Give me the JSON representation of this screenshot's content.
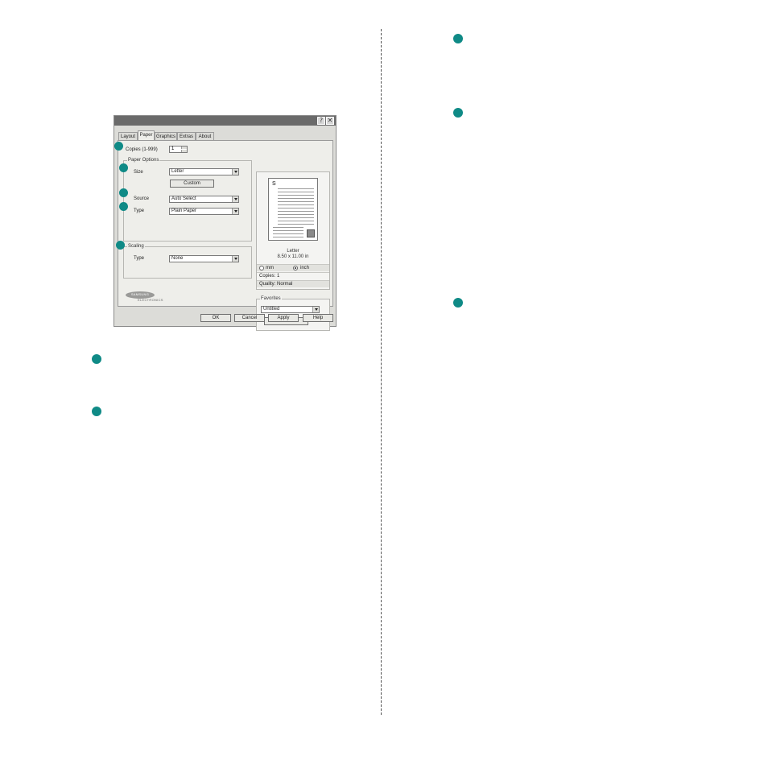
{
  "dialog": {
    "title_buttons": {
      "help": "?",
      "close": "✕"
    },
    "tabs": [
      "Layout",
      "Paper",
      "Graphics",
      "Extras",
      "About"
    ],
    "active_tab": "Paper",
    "copies": {
      "label": "Copies (1-999)",
      "value": "1"
    },
    "paper_options": {
      "title": "Paper Options",
      "size_label": "Size",
      "size_value": "Letter",
      "custom_button": "Custom",
      "source_label": "Source",
      "source_value": "Auto Select",
      "type_label": "Type",
      "type_value": "Plain Paper"
    },
    "scaling": {
      "title": "Scaling",
      "type_label": "Type",
      "type_value": "None"
    },
    "preview": {
      "paper_name": "Letter",
      "paper_dims": "8.50 x 11.00 in",
      "unit_mm": "mm",
      "unit_inch": "inch",
      "selected_unit": "inch",
      "copies_info": "Copies: 1",
      "quality_info": "Quality: Normal"
    },
    "favorites": {
      "title": "Favorites",
      "value": "Untitled",
      "save_button": "Save"
    },
    "logo": {
      "brand": "SAMSUNG",
      "sub": "ELECTRONICS"
    },
    "buttons": {
      "ok": "OK",
      "cancel": "Cancel",
      "apply": "Apply",
      "help": "Help"
    }
  },
  "colors": {
    "marker": "#0f8a86",
    "titlebar": "#6a6a6a",
    "dialog_bg": "#dcdcd8"
  }
}
